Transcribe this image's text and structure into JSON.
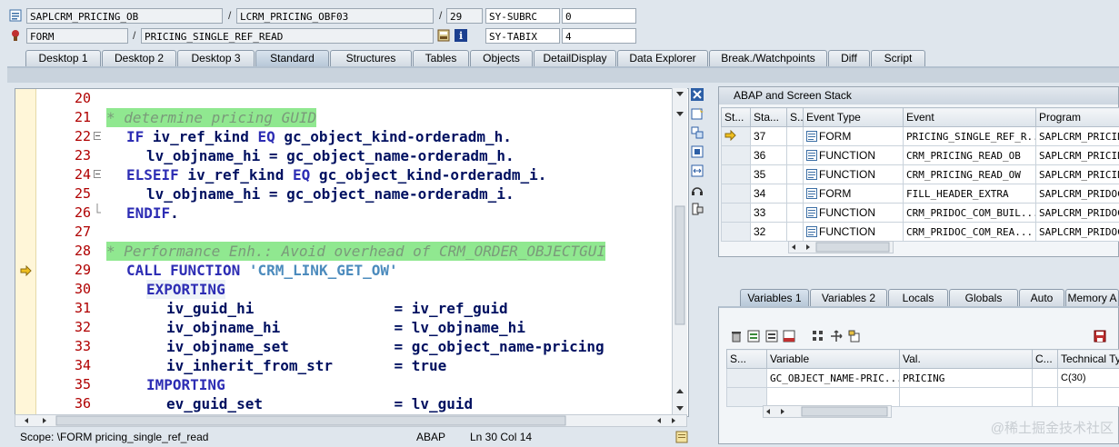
{
  "header": {
    "program": "SAPLCRM_PRICING_OB",
    "include": "LCRM_PRICING_OBF03",
    "line": "29",
    "sysvar1_name": "SY-SUBRC",
    "sysvar1_value": "0",
    "event_type": "FORM",
    "event_name": "PRICING_SINGLE_REF_READ",
    "sysvar2_name": "SY-TABIX",
    "sysvar2_value": "4",
    "slash": "/"
  },
  "tabs": [
    "Desktop 1",
    "Desktop 2",
    "Desktop 3",
    "Standard",
    "Structures",
    "Tables",
    "Objects",
    "DetailDisplay",
    "Data Explorer",
    "Break./Watchpoints",
    "Diff",
    "Script"
  ],
  "active_tab": "Standard",
  "editor": {
    "lines": [
      {
        "num": "20",
        "text": ""
      },
      {
        "num": "21",
        "text": "* determine pricing GUID"
      },
      {
        "num": "22",
        "text": "IF iv_ref_kind EQ gc_object_kind-orderadm_h."
      },
      {
        "num": "23",
        "text": "lv_objname_hi = gc_object_name-orderadm_h."
      },
      {
        "num": "24",
        "text": "ELSEIF iv_ref_kind EQ gc_object_kind-orderadm_i."
      },
      {
        "num": "25",
        "text": "lv_objname_hi = gc_object_name-orderadm_i."
      },
      {
        "num": "26",
        "text": "ENDIF."
      },
      {
        "num": "27",
        "text": ""
      },
      {
        "num": "28",
        "text": "* Performance Enh.: Avoid overhead of CRM_ORDER_OBJECTGUI"
      },
      {
        "num": "29",
        "text": "CALL FUNCTION 'CRM_LINK_GET_OW'"
      },
      {
        "num": "30",
        "text": "EXPORTING"
      },
      {
        "num": "31",
        "text": "iv_guid_hi                = iv_ref_guid"
      },
      {
        "num": "32",
        "text": "iv_objname_hi             = lv_objname_hi"
      },
      {
        "num": "33",
        "text": "iv_objname_set            = gc_object_name-pricing"
      },
      {
        "num": "34",
        "text": "iv_inherit_from_str       = true"
      },
      {
        "num": "35",
        "text": "IMPORTING"
      },
      {
        "num": "36",
        "text": "ev_guid_set               = lv_guid"
      }
    ]
  },
  "status": {
    "scope": "Scope: \\FORM pricing_single_ref_read",
    "language": "ABAP",
    "position": "Ln  30 Col  14"
  },
  "stack": {
    "title": "ABAP and Screen Stack",
    "columns": [
      "St...",
      "Sta...",
      "S...",
      "Event Type",
      "Event",
      "Program"
    ],
    "rows": [
      {
        "level": "37",
        "type": "FORM",
        "event": "PRICING_SINGLE_REF_R...",
        "program": "SAPLCRM_PRICIN",
        "current": true
      },
      {
        "level": "36",
        "type": "FUNCTION",
        "event": "CRM_PRICING_READ_OB",
        "program": "SAPLCRM_PRICIN",
        "current": false
      },
      {
        "level": "35",
        "type": "FUNCTION",
        "event": "CRM_PRICING_READ_OW",
        "program": "SAPLCRM_PRICIN",
        "current": false
      },
      {
        "level": "34",
        "type": "FORM",
        "event": "FILL_HEADER_EXTRA",
        "program": "SAPLCRM_PRIDOC",
        "current": false
      },
      {
        "level": "33",
        "type": "FUNCTION",
        "event": "CRM_PRIDOC_COM_BUIL...",
        "program": "SAPLCRM_PRIDOC",
        "current": false
      },
      {
        "level": "32",
        "type": "FUNCTION",
        "event": "CRM_PRIDOC_COM_REA...",
        "program": "SAPLCRM_PRIDOC",
        "current": false
      }
    ]
  },
  "var_tabs": [
    "Variables 1",
    "Variables 2",
    "Locals",
    "Globals",
    "Auto",
    "Memory A"
  ],
  "variables": {
    "columns": [
      "S...",
      "Variable",
      "Val.",
      "C...",
      "Technical Ty"
    ],
    "rows": [
      {
        "variable": "GC_OBJECT_NAME-PRIC...",
        "value": "PRICING",
        "type": "C(30)"
      }
    ]
  },
  "watermark": "@稀土掘金技术社区",
  "colors": {
    "comment_bg": "#90e890",
    "keyword": "#2d2db4",
    "line_number": "#b00000"
  }
}
